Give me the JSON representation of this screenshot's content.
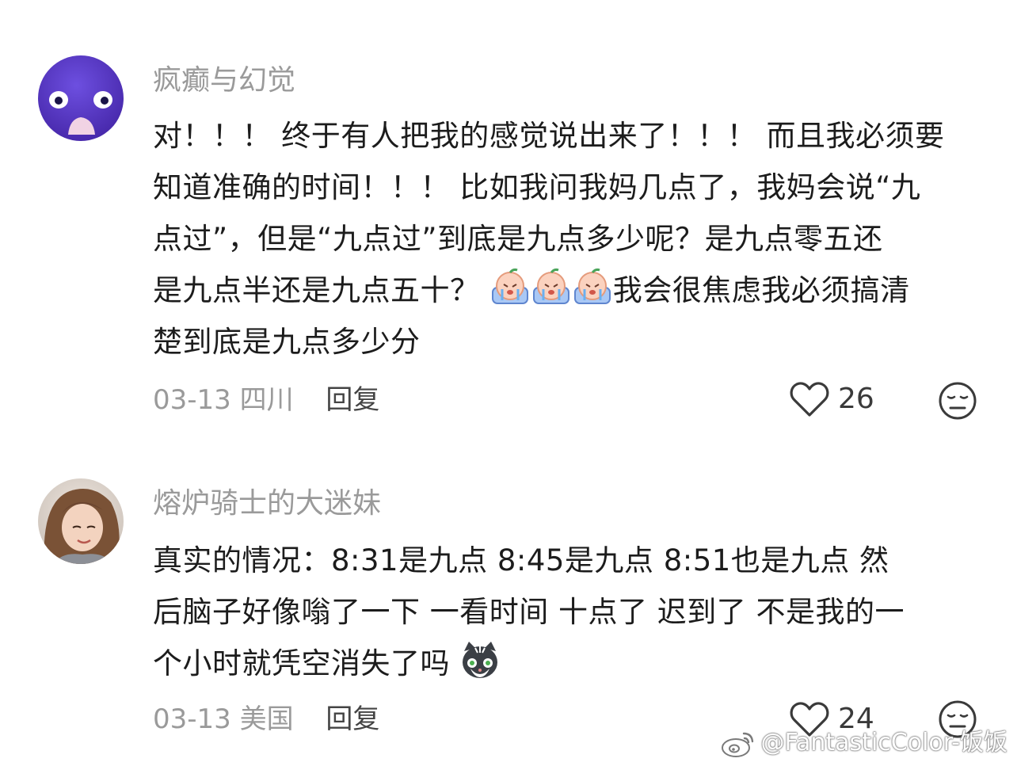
{
  "comments": [
    {
      "username": "疯癫与幻觉",
      "lines": [
        "对！！！ 终于有人把我的感觉说出来了！！！ 而且我必须要",
        "知道准确的时间！！！ 比如我问我妈几点了，我妈会说“九",
        "点过”，但是“九点过”到底是九点多少呢？是九点零五还",
        "是九点半还是九点五十？",
        "我会很焦虑我必须搞清",
        "楚到底是九点多少分"
      ],
      "emoji": "crying-peach-emoji",
      "date": "03-13",
      "location": "四川",
      "reply_label": "回复",
      "like_count": "26"
    },
    {
      "username": "熔炉骑士的大迷妹",
      "lines": [
        "真实的情况：8:31是九点 8:45是九点 8:51也是九点 然",
        "后脑子好像嗡了一下 一看时间 十点了 迟到了 不是我的一",
        "个小时就凭空消失了吗"
      ],
      "emoji": "shocked-cat-emoji",
      "date": "03-13",
      "location": "美国",
      "reply_label": "回复",
      "like_count": "24"
    }
  ],
  "watermark": {
    "text": "@FantasticColor-饭饭"
  },
  "icons": {
    "like": "heart-outline-icon",
    "dislike": "neutral-face-icon",
    "watermark": "weibo-icon"
  },
  "colors": {
    "username": "#9a9a9a",
    "text": "#1c1c1c",
    "meta": "#9a9a9a",
    "avatar1": "#5b3fc4"
  }
}
